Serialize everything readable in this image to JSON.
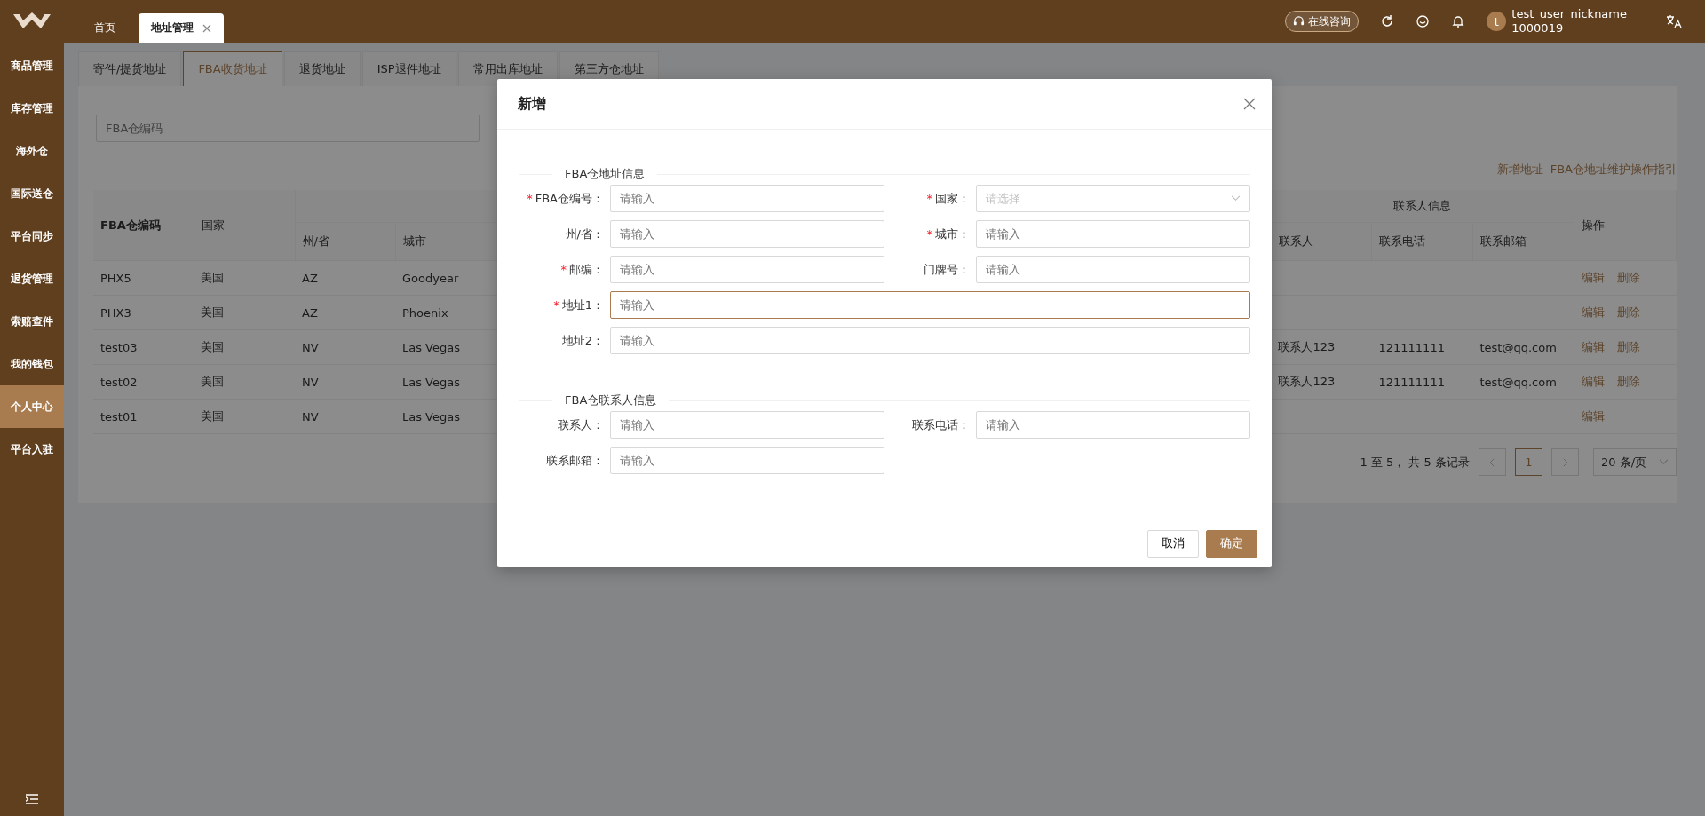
{
  "top_bar": {
    "tabs": [
      {
        "label": "首页",
        "selected": false,
        "closable": false
      },
      {
        "label": "地址管理",
        "selected": true,
        "closable": true
      }
    ],
    "consult": "在线咨询",
    "user": {
      "avatar_letter": "t",
      "name": "test_user_nickname",
      "id": "1000019"
    }
  },
  "sidebar": {
    "items": [
      {
        "label": "商品管理",
        "selected": false
      },
      {
        "label": "库存管理",
        "selected": false
      },
      {
        "label": "海外仓",
        "selected": false
      },
      {
        "label": "国际送仓",
        "selected": false
      },
      {
        "label": "平台同步",
        "selected": false
      },
      {
        "label": "退货管理",
        "selected": false
      },
      {
        "label": "索赔查件",
        "selected": false
      },
      {
        "label": "我的钱包",
        "selected": false
      },
      {
        "label": "个人中心",
        "selected": true
      },
      {
        "label": "平台入驻",
        "selected": false
      }
    ]
  },
  "sub_tabs": [
    {
      "label": "寄件/提货地址",
      "selected": false
    },
    {
      "label": "FBA收货地址",
      "selected": true
    },
    {
      "label": "退货地址",
      "selected": false
    },
    {
      "label": "ISP退件地址",
      "selected": false
    },
    {
      "label": "常用出库地址",
      "selected": false
    },
    {
      "label": "第三方仓地址",
      "selected": false
    }
  ],
  "search": {
    "placeholder": "FBA仓编码"
  },
  "links": [
    "新增地址",
    "FBA仓地址维护操作指引"
  ],
  "table": {
    "headers": {
      "code": "FBA仓编码",
      "country": "国家",
      "state": "州/省",
      "city": "城市",
      "contact_group": "联系人信息",
      "contact": "联系人",
      "phone": "联系电话",
      "email": "联系邮箱",
      "actions": "操作"
    },
    "rows": [
      {
        "code": "PHX5",
        "country": "美国",
        "state": "AZ",
        "city": "Goodyear",
        "actions": [
          "编辑",
          "删除"
        ]
      },
      {
        "code": "PHX3",
        "country": "美国",
        "state": "AZ",
        "city": "Phoenix",
        "actions": [
          "编辑",
          "删除"
        ]
      },
      {
        "code": "test03",
        "country": "美国",
        "state": "NV",
        "city": "Las Vegas",
        "contact": "联系人123",
        "phone": "121111111",
        "email": "test@qq.com",
        "actions": [
          "编辑",
          "删除"
        ]
      },
      {
        "code": "test02",
        "country": "美国",
        "state": "NV",
        "city": "Las Vegas",
        "contact": "联系人123",
        "phone": "121111111",
        "email": "test@qq.com",
        "actions": [
          "编辑",
          "删除"
        ]
      },
      {
        "code": "test01",
        "country": "美国",
        "state": "NV",
        "city": "Las Vegas",
        "actions": [
          "编辑"
        ]
      }
    ]
  },
  "pagination": {
    "summary": "1 至 5， 共 5 条记录",
    "pages": [
      {
        "label": "1",
        "selected": true
      }
    ],
    "page_size": "20 条/页"
  },
  "modal": {
    "title": "新增",
    "required_mark": "*",
    "sections": [
      {
        "title": "FBA仓地址信息",
        "fields": [
          {
            "kind": "input",
            "label": "FBA仓编号：",
            "required": true,
            "placeholder": "请输入",
            "full": false,
            "focused": false
          },
          {
            "kind": "select",
            "label": "国家：",
            "required": true,
            "placeholder": "请选择",
            "full": false,
            "focused": false
          },
          {
            "kind": "input",
            "label": "州/省：",
            "required": false,
            "placeholder": "请输入",
            "full": false,
            "focused": false
          },
          {
            "kind": "input",
            "label": "城市：",
            "required": true,
            "placeholder": "请输入",
            "full": false,
            "focused": false
          },
          {
            "kind": "input",
            "label": "邮编：",
            "required": true,
            "placeholder": "请输入",
            "full": false,
            "focused": false
          },
          {
            "kind": "input",
            "label": "门牌号：",
            "required": false,
            "placeholder": "请输入",
            "full": false,
            "focused": false
          },
          {
            "kind": "input",
            "label": "地址1：",
            "required": true,
            "placeholder": "请输入",
            "full": true,
            "focused": true
          },
          {
            "kind": "input",
            "label": "地址2：",
            "required": false,
            "placeholder": "请输入",
            "full": true,
            "focused": false
          }
        ]
      },
      {
        "title": "FBA仓联系人信息",
        "fields": [
          {
            "kind": "input",
            "label": "联系人：",
            "required": false,
            "placeholder": "请输入",
            "full": false,
            "focused": false
          },
          {
            "kind": "input",
            "label": "联系电话：",
            "required": false,
            "placeholder": "请输入",
            "full": false,
            "focused": false
          },
          {
            "kind": "input",
            "label": "联系邮箱：",
            "required": false,
            "placeholder": "请输入",
            "full": false,
            "focused": false
          }
        ]
      }
    ],
    "buttons": [
      {
        "label": "取消",
        "kind": "secondary"
      },
      {
        "label": "确定",
        "kind": "primary"
      }
    ]
  }
}
